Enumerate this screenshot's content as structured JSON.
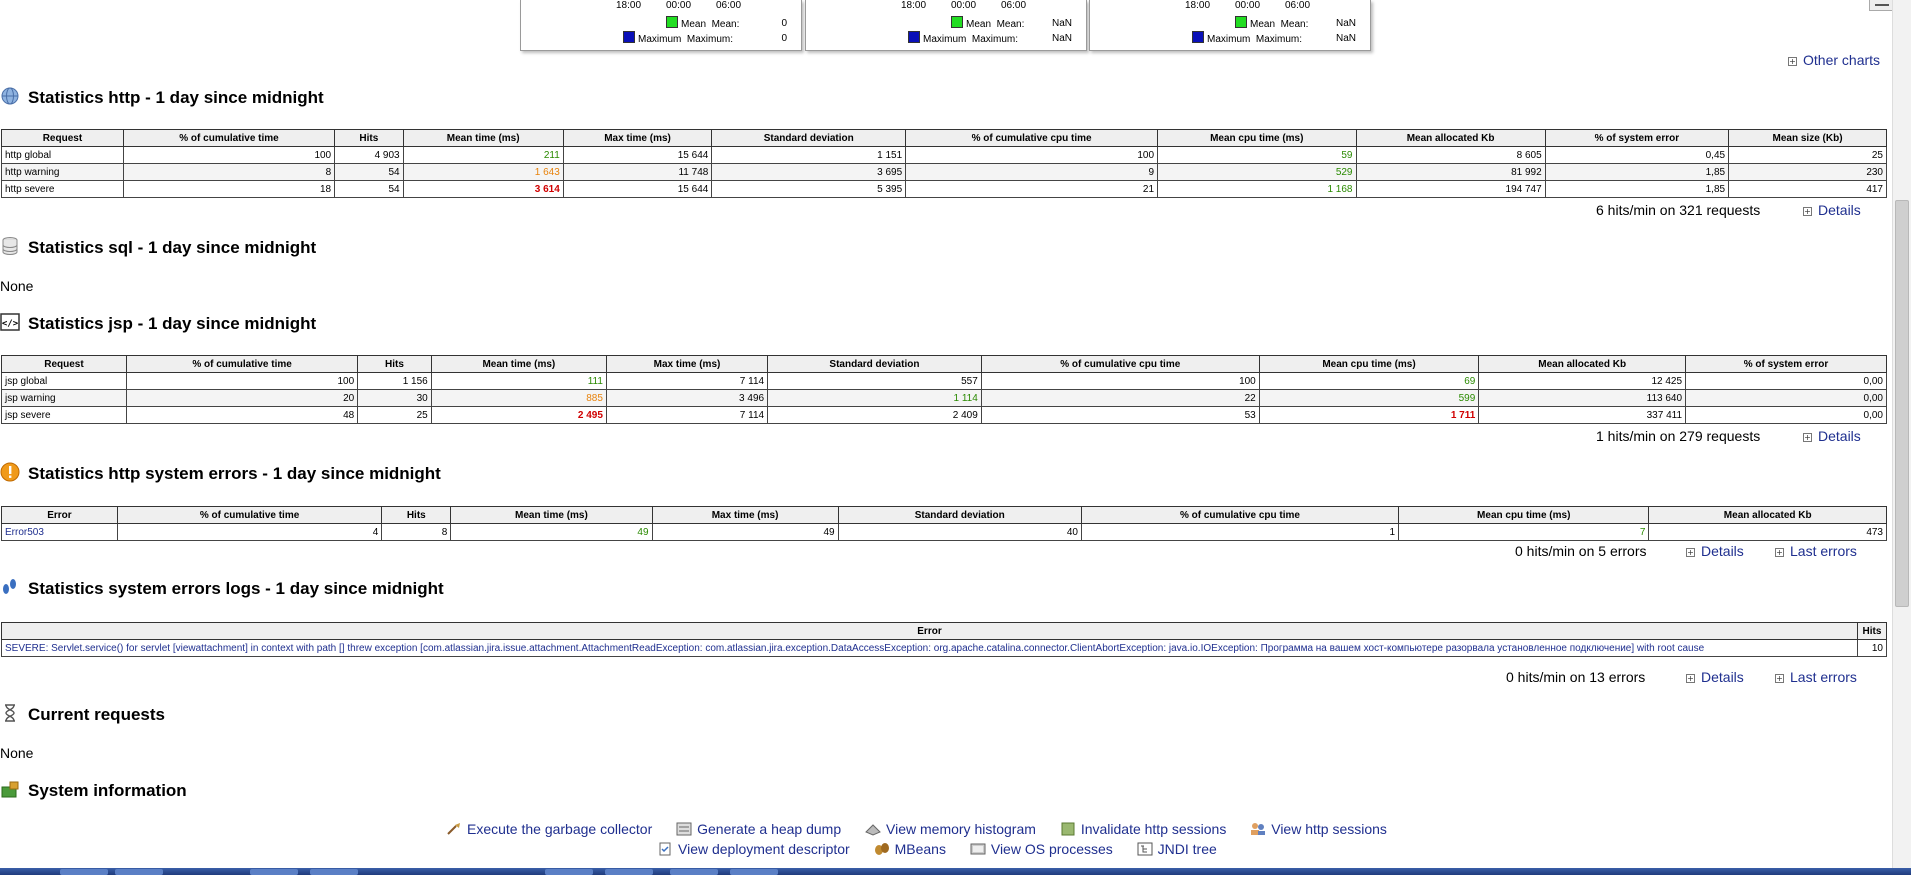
{
  "charts": [
    {
      "times": [
        "18:00",
        "00:00",
        "06:00"
      ],
      "mean_label": "Mean",
      "mean_key": "Mean:",
      "mean_val": "0",
      "max_label": "Maximum",
      "max_key": "Maximum:",
      "max_val": "0"
    },
    {
      "times": [
        "18:00",
        "00:00",
        "06:00"
      ],
      "mean_label": "Mean",
      "mean_key": "Mean:",
      "mean_val": "NaN",
      "max_label": "Maximum",
      "max_key": "Maximum:",
      "max_val": "NaN"
    },
    {
      "times": [
        "18:00",
        "00:00",
        "06:00"
      ],
      "mean_label": "Mean",
      "mean_key": "Mean:",
      "mean_val": "NaN",
      "max_label": "Maximum",
      "max_key": "Maximum:",
      "max_val": "NaN"
    }
  ],
  "other_charts": "Other charts",
  "http": {
    "title": "Statistics http - 1 day since midnight",
    "headers": [
      "Request",
      "% of cumulative time",
      "Hits",
      "Mean time (ms)",
      "Max time (ms)",
      "Standard deviation",
      "% of cumulative cpu time",
      "Mean cpu time (ms)",
      "Mean allocated Kb",
      "% of system error",
      "Mean size (Kb)"
    ],
    "rows": [
      [
        "http global",
        "100",
        "4 903",
        "211",
        "15 644",
        "1 151",
        "100",
        "59",
        "8 605",
        "0,45",
        "25"
      ],
      [
        "http warning",
        "8",
        "54",
        "1 643",
        "11 748",
        "3 695",
        "9",
        "529",
        "81 992",
        "1,85",
        "230"
      ],
      [
        "http severe",
        "18",
        "54",
        "3 614",
        "15 644",
        "5 395",
        "21",
        "1 168",
        "194 747",
        "1,85",
        "417"
      ]
    ],
    "summary": "6 hits/min on 321 requests",
    "details": "Details"
  },
  "sql": {
    "title": "Statistics sql - 1 day since midnight",
    "none": "None"
  },
  "jsp": {
    "title": "Statistics jsp - 1 day since midnight",
    "headers": [
      "Request",
      "% of cumulative time",
      "Hits",
      "Mean time (ms)",
      "Max time (ms)",
      "Standard deviation",
      "% of cumulative cpu time",
      "Mean cpu time (ms)",
      "Mean allocated Kb",
      "% of system error"
    ],
    "rows": [
      [
        "jsp global",
        "100",
        "1 156",
        "111",
        "7 114",
        "557",
        "100",
        "69",
        "12 425",
        "0,00"
      ],
      [
        "jsp warning",
        "20",
        "30",
        "885",
        "3 496",
        "1 114",
        "22",
        "599",
        "113 640",
        "0,00"
      ],
      [
        "jsp severe",
        "48",
        "25",
        "2 495",
        "7 114",
        "2 409",
        "53",
        "1 711",
        "337 411",
        "0,00"
      ]
    ],
    "summary": "1 hits/min on 279 requests",
    "details": "Details"
  },
  "http_errors": {
    "title": "Statistics http system errors - 1 day since midnight",
    "headers": [
      "Error",
      "% of cumulative time",
      "Hits",
      "Mean time (ms)",
      "Max time (ms)",
      "Standard deviation",
      "% of cumulative cpu time",
      "Mean cpu time (ms)",
      "Mean allocated Kb"
    ],
    "rows": [
      [
        "Error503",
        "4",
        "8",
        "49",
        "49",
        "40",
        "1",
        "7",
        "473"
      ]
    ],
    "summary": "0 hits/min on 5 errors",
    "details": "Details",
    "last_errors": "Last errors"
  },
  "error_logs": {
    "title": "Statistics system errors logs - 1 day since midnight",
    "headers": [
      "Error",
      "Hits"
    ],
    "row_error": "SEVERE: Servlet.service() for servlet [viewattachment] in context with path [] threw exception [com.atlassian.jira.issue.attachment.AttachmentReadException: com.atlassian.jira.exception.DataAccessException: org.apache.catalina.connector.ClientAbortException: java.io.IOException: Программа на вашем хост-компьютере разорвала установленное подключение] with root cause",
    "row_hits": "10",
    "summary": "0 hits/min on 13 errors",
    "details": "Details",
    "last_errors": "Last errors"
  },
  "current_requests": {
    "title": "Current requests",
    "none": "None"
  },
  "system_info": {
    "title": "System information",
    "actions_row1": [
      "Execute the garbage collector",
      "Generate a heap dump",
      "View memory histogram",
      "Invalidate http sessions",
      "View http sessions"
    ],
    "actions_row2": [
      "View deployment descriptor",
      "MBeans",
      "View OS processes",
      "JNDI tree"
    ]
  },
  "colors": {
    "link": "#1f2f8f",
    "good": "#2a8a00",
    "warning": "#e8830c",
    "severe": "#d00000"
  }
}
